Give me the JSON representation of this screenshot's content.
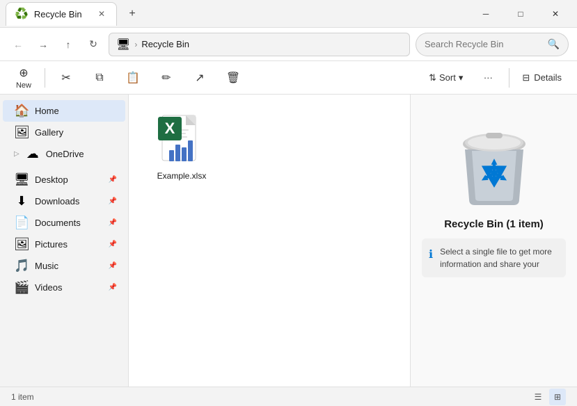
{
  "titlebar": {
    "tab_title": "Recycle Bin",
    "tab_icon": "♻️",
    "close_label": "✕",
    "add_label": "+",
    "minimize_label": "─",
    "maximize_label": "□",
    "winclose_label": "✕"
  },
  "addressbar": {
    "back_icon": "←",
    "forward_icon": "→",
    "up_icon": "↑",
    "refresh_icon": "↻",
    "monitor_icon": "🖥",
    "separator": "›",
    "location": "Recycle Bin",
    "search_placeholder": "Search Recycle Bin",
    "search_icon": "🔍"
  },
  "toolbar": {
    "new_label": "New",
    "cut_icon": "✂",
    "copy_icon": "⧉",
    "paste_icon": "📋",
    "rename_icon": "✏",
    "share_icon": "↗",
    "delete_icon": "🗑",
    "sort_label": "Sort",
    "more_label": "···",
    "details_label": "Details"
  },
  "sidebar": {
    "items": [
      {
        "label": "Home",
        "icon": "🏠",
        "active": true,
        "pinned": false
      },
      {
        "label": "Gallery",
        "icon": "🖼",
        "active": false,
        "pinned": false
      },
      {
        "label": "OneDrive",
        "icon": "☁",
        "active": false,
        "pinned": false,
        "expandable": true
      },
      {
        "label": "Desktop",
        "icon": "🖥",
        "active": false,
        "pinned": true
      },
      {
        "label": "Downloads",
        "icon": "⬇",
        "active": false,
        "pinned": true
      },
      {
        "label": "Documents",
        "icon": "📄",
        "active": false,
        "pinned": true
      },
      {
        "label": "Pictures",
        "icon": "🖼",
        "active": false,
        "pinned": true
      },
      {
        "label": "Music",
        "icon": "🎵",
        "active": false,
        "pinned": true
      },
      {
        "label": "Videos",
        "icon": "🎬",
        "active": false,
        "pinned": true
      }
    ]
  },
  "file": {
    "name": "Example.xlsx",
    "chart_bars": [
      18,
      28,
      22,
      35
    ]
  },
  "details_panel": {
    "title": "Recycle Bin (1 item)",
    "info_text": "Select a single file to get more information and share your"
  },
  "statusbar": {
    "item_count": "1 item"
  }
}
